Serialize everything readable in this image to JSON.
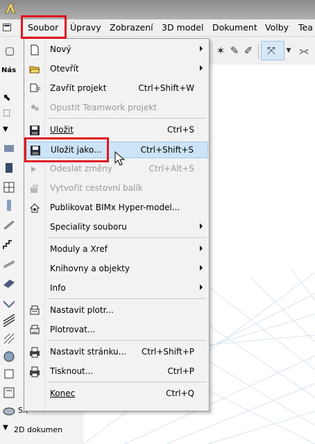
{
  "menubar": {
    "items": [
      "Soubor",
      "Úpravy",
      "Zobrazení",
      "3D model",
      "Dokument",
      "Volby",
      "Tea"
    ]
  },
  "toolbox": {
    "header": "Nás",
    "labels": [
      "Síť",
      "2D dokumen"
    ]
  },
  "menu": {
    "items": [
      {
        "label": "Nový",
        "shortcut": "",
        "submenu": true,
        "disabled": false,
        "icon": "new-document-icon"
      },
      {
        "label": "Otevřít",
        "shortcut": "",
        "submenu": true,
        "disabled": false,
        "icon": "open-folder-icon"
      },
      {
        "label": "Zavřít projekt",
        "shortcut": "Ctrl+Shift+W",
        "submenu": false,
        "disabled": false,
        "icon": "close-project-icon"
      },
      {
        "label": "Opustit Teamwork projekt",
        "shortcut": "",
        "submenu": false,
        "disabled": true,
        "icon": "leave-teamwork-icon"
      },
      {
        "label": "Uložit",
        "shortcut": "Ctrl+S",
        "submenu": false,
        "disabled": false,
        "icon": "save-icon"
      },
      {
        "label": "Uložit jako...",
        "shortcut": "Ctrl+Shift+S",
        "submenu": false,
        "disabled": false,
        "icon": "save-as-icon",
        "highlighted": true
      },
      {
        "label": "Odeslat změny",
        "shortcut": "Ctrl+Alt+S",
        "submenu": false,
        "disabled": true,
        "icon": "send-changes-icon"
      },
      {
        "label": "Vytvořit cestovní balík",
        "shortcut": "",
        "submenu": false,
        "disabled": true,
        "icon": "travel-pack-icon"
      },
      {
        "label": "Publikovat BIMx Hyper-model...",
        "shortcut": "",
        "submenu": false,
        "disabled": false,
        "icon": "bimx-publish-icon"
      },
      {
        "label": "Speciality souboru",
        "shortcut": "",
        "submenu": true,
        "disabled": false,
        "icon": ""
      },
      {
        "label": "Moduly a Xref",
        "shortcut": "",
        "submenu": true,
        "disabled": false,
        "icon": ""
      },
      {
        "label": "Knihovny a objekty",
        "shortcut": "",
        "submenu": true,
        "disabled": false,
        "icon": ""
      },
      {
        "label": "Info",
        "shortcut": "",
        "submenu": true,
        "disabled": false,
        "icon": ""
      },
      {
        "label": "Nastavit plotr...",
        "shortcut": "",
        "submenu": false,
        "disabled": false,
        "icon": "plotter-setup-icon"
      },
      {
        "label": "Plotrovat...",
        "shortcut": "",
        "submenu": false,
        "disabled": false,
        "icon": "plot-icon"
      },
      {
        "label": "Nastavit stránku...",
        "shortcut": "Ctrl+Shift+P",
        "submenu": false,
        "disabled": false,
        "icon": "page-setup-icon"
      },
      {
        "label": "Tisknout...",
        "shortcut": "Ctrl+P",
        "submenu": false,
        "disabled": false,
        "icon": "print-icon"
      },
      {
        "label": "Konec",
        "shortcut": "Ctrl+Q",
        "submenu": false,
        "disabled": false,
        "icon": ""
      }
    ]
  },
  "colors": {
    "highlight_box": "#e0141e",
    "hover_bg": "#cce4f7",
    "hover_border": "#99c9ef"
  }
}
